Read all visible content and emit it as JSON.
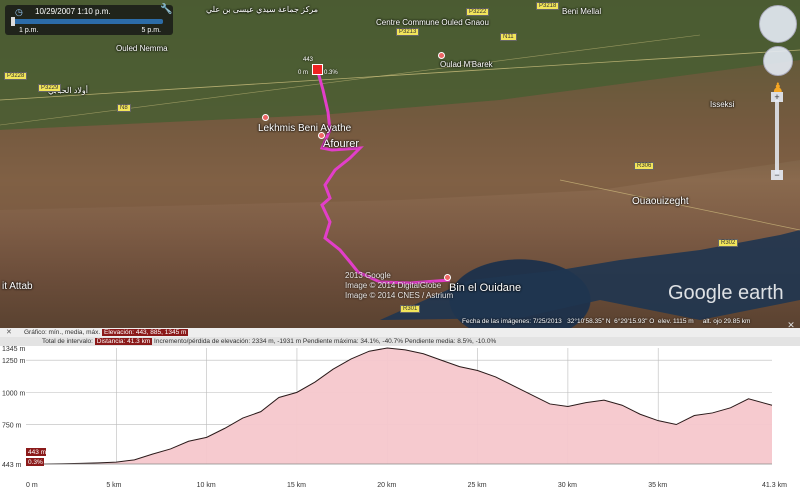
{
  "time_slider": {
    "date_text": "10/29/2007   1:10 p.m.",
    "left_label": "1 p.m.",
    "right_label": "5 p.m."
  },
  "map": {
    "places": [
      {
        "name": "Lekhmis Beni Ayathe"
      },
      {
        "name": "Afourer"
      },
      {
        "name": "Bin el Ouidane"
      },
      {
        "name": "Ouaouizeght"
      },
      {
        "name": "Oulad M'Barek"
      },
      {
        "name": "Centre Commune Ouled Gnaou"
      },
      {
        "name": "Isseksi"
      },
      {
        "name": "Ouled Nemma"
      },
      {
        "name": "Beni Mellal"
      },
      {
        "name": "it Attab"
      },
      {
        "name": "أولاد الحبابي"
      },
      {
        "name": "مركز جماعة سيدي عيسى بن علي"
      }
    ],
    "roads": [
      "P3222",
      "P3218",
      "P3228",
      "R306",
      "R302",
      "R301",
      "N8",
      "N11",
      "P3213",
      "P3229"
    ],
    "marker": {
      "elev_label": "443",
      "left_label": "0 m",
      "right_label": "0.3%"
    },
    "copyright": [
      "2013 Google",
      "Image © 2014 DigitalGlobe",
      "Image © 2014 CNES / Astrium"
    ],
    "logo_text": "Google earth",
    "status": {
      "date": "Fecha de las imágenes: 7/25/2013",
      "lat": "32°10'58.35\" N",
      "lon": "6°29'15.93\" O",
      "elev": "elev.  1115 m",
      "alt": "alt. ojo  29.85 km"
    },
    "colors": {
      "track": "#e23ec9",
      "water": "#20324a"
    }
  },
  "profile": {
    "info1_prefix": "Gráfico: mín., media, máx.",
    "info1_highlight": "Elevación: 443, 885, 1345 m",
    "info2_prefix": "Total de intervalo:",
    "info2_highlight": "Distancia: 41.3 km",
    "info2_rest": "Incremento/pérdida de elevación: 2334 m, -1931 m  Pendiente máxima: 34.1%, -40.7%  Pendiente media: 8.5%, -10.0%"
  },
  "chart_data": {
    "type": "area",
    "x": [
      0,
      1,
      2,
      3,
      4,
      5,
      6,
      7,
      8,
      9,
      10,
      11,
      12,
      13,
      14,
      15,
      16,
      17,
      18,
      19,
      20,
      21,
      22,
      23,
      24,
      25,
      26,
      27,
      28,
      29,
      30,
      31,
      32,
      33,
      34,
      35,
      36,
      37,
      38,
      39,
      40,
      41.3
    ],
    "series": [
      {
        "values": [
          443,
          443,
          445,
          448,
          452,
          458,
          475,
          520,
          560,
          620,
          650,
          720,
          800,
          850,
          960,
          1000,
          1080,
          1180,
          1260,
          1320,
          1345,
          1330,
          1300,
          1250,
          1200,
          1170,
          1120,
          1050,
          980,
          910,
          890,
          920,
          940,
          900,
          830,
          780,
          750,
          820,
          840,
          880,
          950,
          900
        ]
      }
    ],
    "ylim": [
      443,
      1345
    ],
    "xlim": [
      0,
      41.3
    ],
    "x_ticks": [
      "0 m",
      "5 km",
      "10 km",
      "15 km",
      "20 km",
      "25 km",
      "30 km",
      "35 km",
      "41.3 km"
    ],
    "y_ticks": [
      "443 m",
      "750 m",
      "1000 m",
      "1250 m",
      "1345 m"
    ],
    "cursor_labels": [
      "443 m",
      "0.3%"
    ],
    "grid": true,
    "colors": {
      "line": "#2a1a1a",
      "fill": "#f6c7cc",
      "grid": "#bbb"
    }
  }
}
